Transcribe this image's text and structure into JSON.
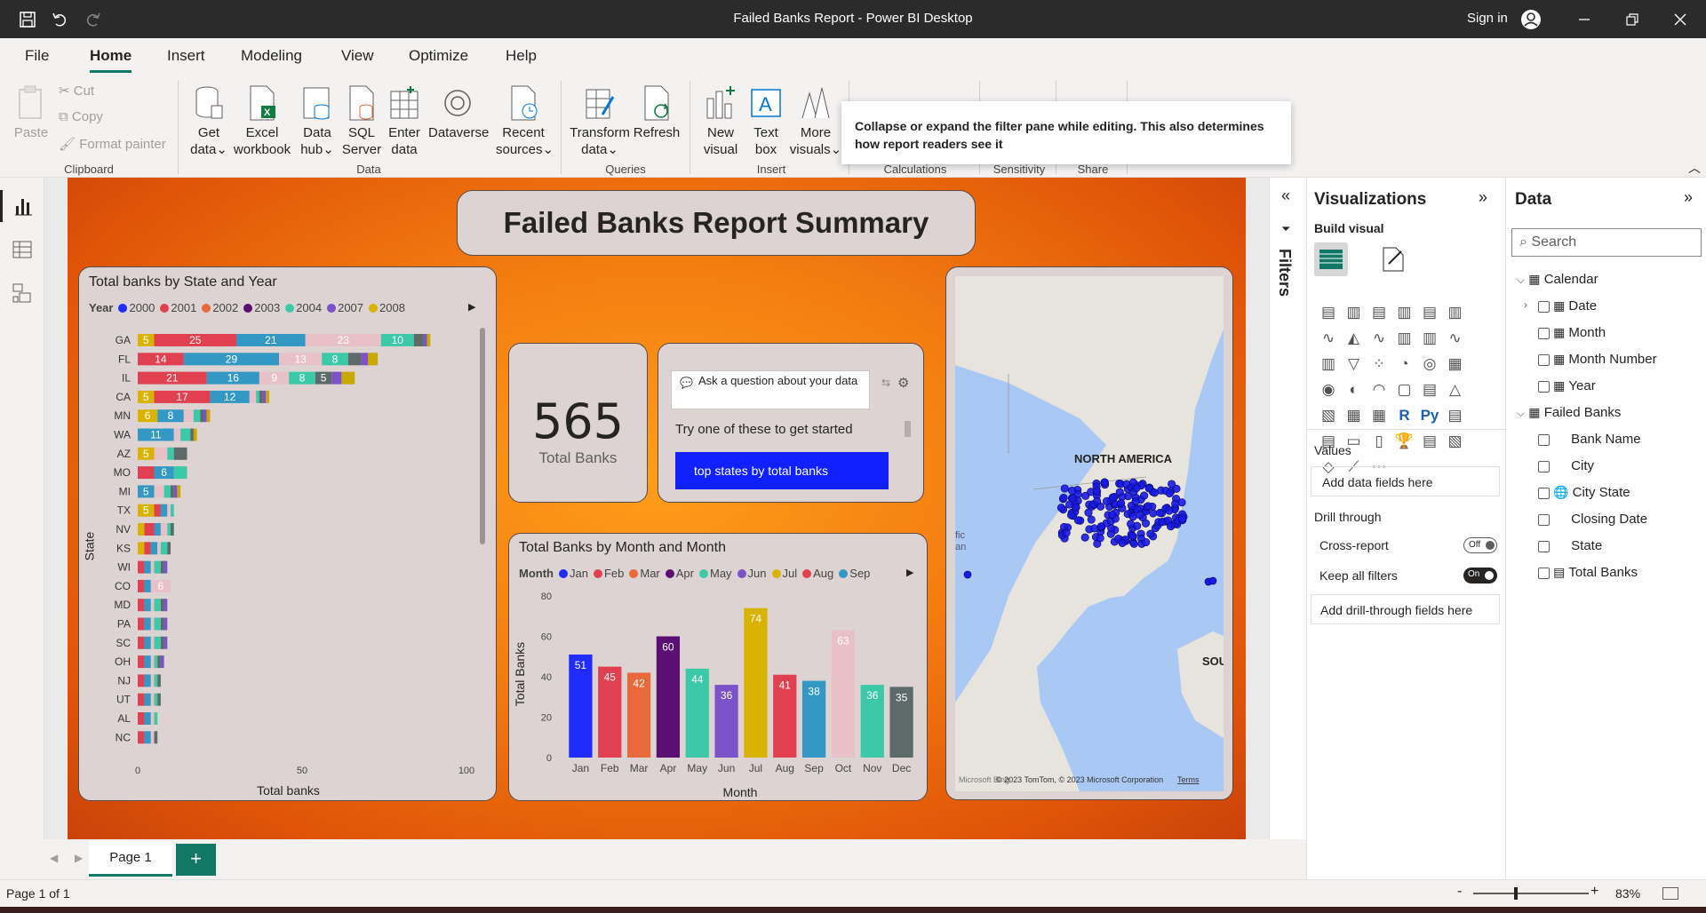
{
  "window": {
    "title": "Failed Banks Report - Power BI Desktop",
    "sign_in": "Sign in"
  },
  "menu": {
    "file": "File",
    "home": "Home",
    "insert": "Insert",
    "modeling": "Modeling",
    "view": "View",
    "optimize": "Optimize",
    "help": "Help"
  },
  "ribbon": {
    "paste": "Paste",
    "cut": "Cut",
    "copy": "Copy",
    "format_painter": "Format painter",
    "clipboard": "Clipboard",
    "get_data": [
      "Get",
      "data"
    ],
    "excel": [
      "Excel",
      "workbook"
    ],
    "data_hub": [
      "Data",
      "hub"
    ],
    "sql": [
      "SQL",
      "Server"
    ],
    "enter": [
      "Enter",
      "data"
    ],
    "dataverse": "Dataverse",
    "recent": [
      "Recent",
      "sources"
    ],
    "data_group": "Data",
    "transform": [
      "Transform",
      "data"
    ],
    "refresh": "Refresh",
    "queries": "Queries",
    "new_visual": [
      "New",
      "visual"
    ],
    "text_box": [
      "Text",
      "box"
    ],
    "more_visuals": [
      "More",
      "visuals"
    ],
    "insert_group": "Insert",
    "calculations": "Calculations",
    "sensitivity": "Sensitivity",
    "share": "Share"
  },
  "tooltip": "Collapse or expand the filter pane while editing. This also determines how report readers see it",
  "report": {
    "title": "Failed Banks Report Summary",
    "kpi_value": "565",
    "kpi_label": "Total Banks",
    "qna": {
      "placeholder": "Ask a question about your data",
      "hint": "Try one of these to get started",
      "suggestion": "top states by total banks"
    },
    "map": {
      "label_na": "NORTH AMERICA",
      "label_sou": "SOU",
      "label_fic": "fic",
      "label_an": "an",
      "attribution": "© 2023 TomTom, © 2023 Microsoft Corporation",
      "terms": "Terms",
      "ms_logo": "Microsoft Bing"
    }
  },
  "chart_data": [
    {
      "type": "bar",
      "orientation": "horizontal-stacked",
      "title": "Total banks by State and Year",
      "xlabel": "Total banks",
      "ylabel": "State",
      "xlim": [
        0,
        100
      ],
      "xticks": [
        "0",
        "50",
        "100"
      ],
      "legend_title": "Year",
      "legend": [
        "2000",
        "2001",
        "2002",
        "2003",
        "2004",
        "2007",
        "2008"
      ],
      "legend_colors": [
        "#1f2bff",
        "#e04050",
        "#e8693c",
        "#5b0f72",
        "#3cc9a8",
        "#7b52c8",
        "#d9b300"
      ],
      "categories": [
        "GA",
        "FL",
        "IL",
        "CA",
        "MN",
        "WA",
        "AZ",
        "MO",
        "MI",
        "TX",
        "NV",
        "KS",
        "WI",
        "CO",
        "MD",
        "PA",
        "SC",
        "OH",
        "NJ",
        "UT",
        "AL",
        "NC"
      ],
      "segment_colors": [
        "#d9b300",
        "#e04050",
        "#3399c4",
        "#e8c0c8",
        "#3cc9a8",
        "#5d6a6a",
        "#7b52c8",
        "#c9a800"
      ],
      "totals": [
        89,
        73,
        66,
        40,
        22,
        18,
        15,
        15,
        13,
        11,
        11,
        10,
        9,
        9,
        9,
        9,
        9,
        8,
        7,
        7,
        6,
        6
      ],
      "segments": [
        [
          5,
          25,
          21,
          23,
          10,
          3,
          1,
          1
        ],
        [
          0,
          14,
          29,
          13,
          8,
          4,
          2,
          3
        ],
        [
          0,
          21,
          16,
          9,
          8,
          5,
          3,
          4
        ],
        [
          5,
          17,
          12,
          2,
          1,
          1,
          1,
          1
        ],
        [
          6,
          0,
          8,
          3,
          2,
          1,
          1,
          1
        ],
        [
          0,
          0,
          11,
          2,
          3,
          1,
          0,
          1
        ],
        [
          5,
          0,
          0,
          4,
          2,
          4,
          0,
          0
        ],
        [
          0,
          5,
          6,
          0,
          4,
          0,
          0,
          0
        ],
        [
          0,
          0,
          5,
          3,
          2,
          1,
          1,
          1
        ],
        [
          5,
          2,
          2,
          1,
          1,
          0,
          0,
          0
        ],
        [
          2,
          3,
          2,
          2,
          1,
          1,
          0,
          0
        ],
        [
          2,
          2,
          2,
          1,
          2,
          1,
          0,
          0
        ],
        [
          0,
          2,
          2,
          1,
          2,
          1,
          1,
          0
        ],
        [
          0,
          2,
          2,
          6,
          0,
          0,
          0,
          0
        ],
        [
          0,
          2,
          2,
          1,
          2,
          1,
          1,
          0
        ],
        [
          0,
          2,
          2,
          1,
          2,
          1,
          1,
          0
        ],
        [
          0,
          2,
          2,
          1,
          2,
          1,
          1,
          0
        ],
        [
          0,
          2,
          2,
          1,
          1,
          1,
          1,
          0
        ],
        [
          0,
          2,
          2,
          1,
          1,
          1,
          0,
          0
        ],
        [
          0,
          2,
          2,
          1,
          1,
          1,
          0,
          0
        ],
        [
          0,
          2,
          2,
          1,
          1,
          0,
          0,
          0
        ],
        [
          0,
          2,
          2,
          1,
          0,
          1,
          0,
          0
        ]
      ],
      "labels": [
        [
          "5",
          "25",
          "21",
          "23",
          "10",
          "",
          "",
          ""
        ],
        [
          "",
          "14",
          "29",
          "13",
          "8",
          "",
          "",
          ""
        ],
        [
          "",
          "21",
          "16",
          "9",
          "8",
          "5",
          "",
          ""
        ],
        [
          "5",
          "17",
          "12",
          "",
          "",
          "",
          "",
          ""
        ],
        [
          "6",
          "",
          "8",
          "",
          "",
          "",
          "",
          ""
        ],
        [
          "",
          "",
          "11",
          "",
          "",
          "",
          "",
          ""
        ],
        [
          "5",
          "",
          "",
          "",
          "",
          "",
          "",
          ""
        ],
        [
          "",
          "",
          "6",
          "",
          "",
          "",
          "",
          ""
        ],
        [
          "",
          "",
          "5",
          "",
          "",
          "",
          "",
          ""
        ],
        [
          "5",
          "",
          "",
          "",
          "",
          "",
          "",
          ""
        ],
        [
          "",
          "",
          "",
          "",
          "",
          "",
          "",
          ""
        ],
        [
          "",
          "",
          "",
          "",
          "",
          "",
          "",
          ""
        ],
        [
          "",
          "",
          "",
          "",
          "",
          "",
          "",
          ""
        ],
        [
          "",
          "",
          "",
          "6",
          "",
          "",
          "",
          ""
        ],
        [
          "",
          "",
          "",
          "",
          "",
          "",
          "",
          ""
        ],
        [
          "",
          "",
          "",
          "",
          "",
          "",
          "",
          ""
        ],
        [
          "",
          "",
          "",
          "",
          "",
          "",
          "",
          ""
        ],
        [
          "",
          "",
          "",
          "",
          "",
          "",
          "",
          ""
        ],
        [
          "",
          "",
          "",
          "",
          "",
          "",
          "",
          ""
        ],
        [
          "",
          "",
          "",
          "",
          "",
          "",
          "",
          ""
        ],
        [
          "",
          "",
          "",
          "",
          "",
          "",
          "",
          ""
        ],
        [
          "",
          "",
          "",
          "",
          "",
          "",
          "",
          ""
        ]
      ]
    },
    {
      "type": "bar",
      "title": "Total Banks by Month and Month",
      "xlabel": "Month",
      "ylabel": "Total Banks",
      "ylim": [
        0,
        80
      ],
      "yticks": [
        0,
        20,
        40,
        60,
        80
      ],
      "legend_title": "Month",
      "legend": [
        "Jan",
        "Feb",
        "Mar",
        "Apr",
        "May",
        "Jun",
        "Jul",
        "Aug",
        "Sep"
      ],
      "categories": [
        "Jan",
        "Feb",
        "Mar",
        "Apr",
        "May",
        "Jun",
        "Jul",
        "Aug",
        "Sep",
        "Oct",
        "Nov",
        "Dec"
      ],
      "values": [
        51,
        45,
        42,
        60,
        44,
        36,
        74,
        41,
        38,
        63,
        36,
        35
      ],
      "colors": [
        "#1f2bff",
        "#e04050",
        "#e8693c",
        "#5b0f72",
        "#3cc9a8",
        "#7b52c8",
        "#d9b300",
        "#e04050",
        "#3399c4",
        "#e8c0c8",
        "#3cc9a8",
        "#5d6a6a"
      ]
    }
  ],
  "filters": {
    "label": "Filters"
  },
  "viz": {
    "title": "Visualizations",
    "build_visual": "Build visual",
    "values": "Values",
    "add_fields": "Add data fields here",
    "drill_through": "Drill through",
    "cross_report": "Cross-report",
    "cross_report_state": "Off",
    "keep_filters": "Keep all filters",
    "keep_filters_state": "On",
    "add_drill": "Add drill-through fields here"
  },
  "data_pane": {
    "title": "Data",
    "search_placeholder": "Search",
    "tables": [
      {
        "name": "Calendar",
        "fields": [
          "Date",
          "Month",
          "Month Number",
          "Year"
        ]
      },
      {
        "name": "Failed Banks",
        "fields": [
          "Bank Name",
          "City",
          "City State",
          "Closing Date",
          "State",
          "Total Banks"
        ]
      }
    ]
  },
  "pages": {
    "tab": "Page 1",
    "status": "Page 1 of 1",
    "zoom": "83%"
  }
}
